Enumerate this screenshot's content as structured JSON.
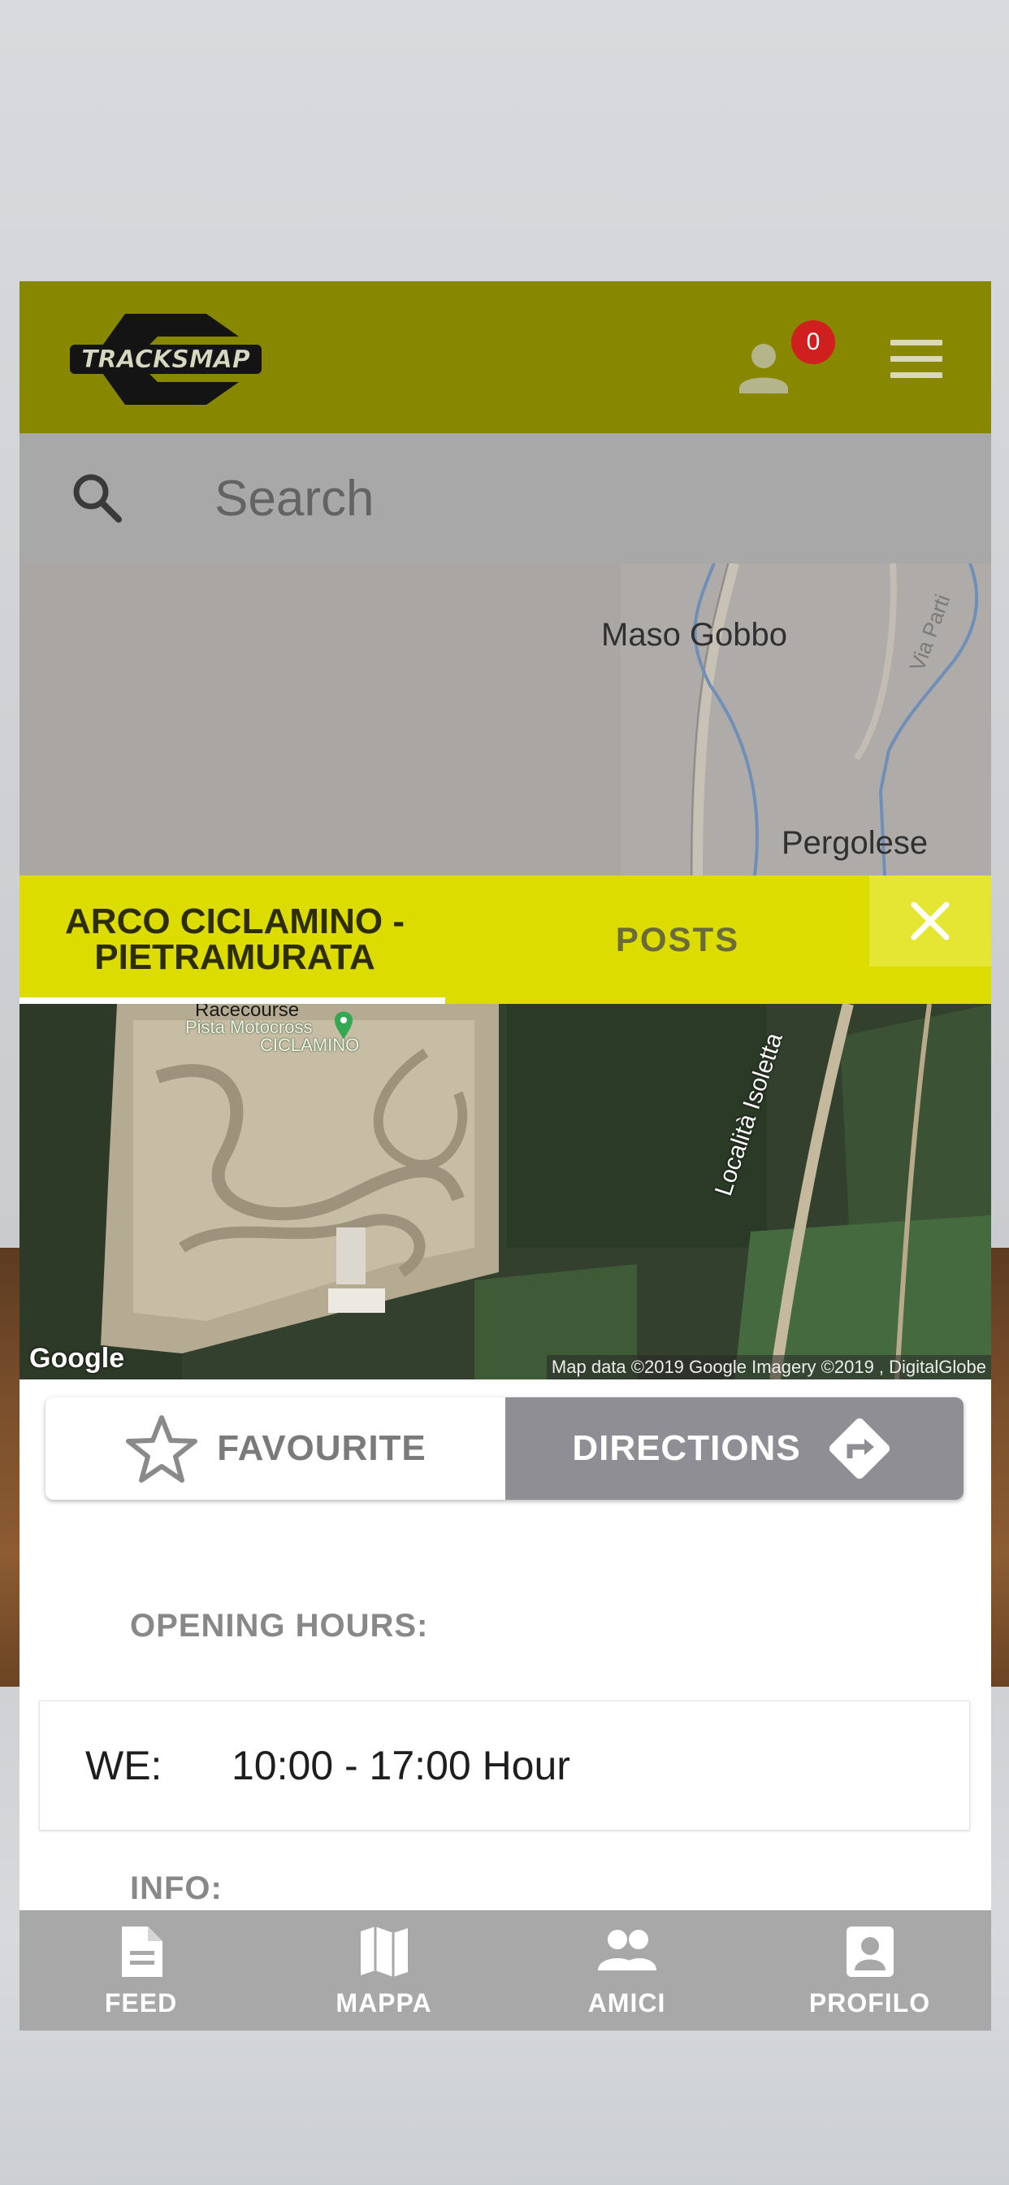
{
  "header": {
    "logo_text": "TRACKSMAP",
    "notification_count": "0"
  },
  "search": {
    "placeholder": "Search"
  },
  "map": {
    "labels": [
      "Maso Gobbo",
      "Via Parti",
      "Pergolese"
    ]
  },
  "tabs": {
    "track_label_line1": "ARCO CICLAMINO -",
    "track_label_line2": "PIETRAMURATA",
    "posts_label": "POSTS"
  },
  "satellite": {
    "place_labels": [
      "Racecourse",
      "Pista Motocross",
      "CICLAMINO"
    ],
    "road_label": "Località Isoletta",
    "attribution": "Map data ©2019 Google  Imagery ©2019 , DigitalGlobe",
    "watermark": "Google"
  },
  "actions": {
    "favourite_label": "FAVOURITE",
    "directions_label": "DIRECTIONS"
  },
  "opening_hours": {
    "title": "OPENING HOURS:",
    "entries": [
      {
        "day": "WE:",
        "hours": "10:00 - 17:00 Hour"
      }
    ]
  },
  "info": {
    "title": "INFO:"
  },
  "bottom_nav": {
    "items": [
      {
        "label": "FEED",
        "icon": "document-icon"
      },
      {
        "label": "MAPPA",
        "icon": "map-icon"
      },
      {
        "label": "AMICI",
        "icon": "people-icon"
      },
      {
        "label": "PROFILO",
        "icon": "profile-icon"
      }
    ]
  },
  "colors": {
    "header": "#878700",
    "tab_bar": "#dcdc00",
    "nav": "#a8a8a8",
    "badge": "#d01f1f",
    "directions_button": "#8f8e95"
  }
}
